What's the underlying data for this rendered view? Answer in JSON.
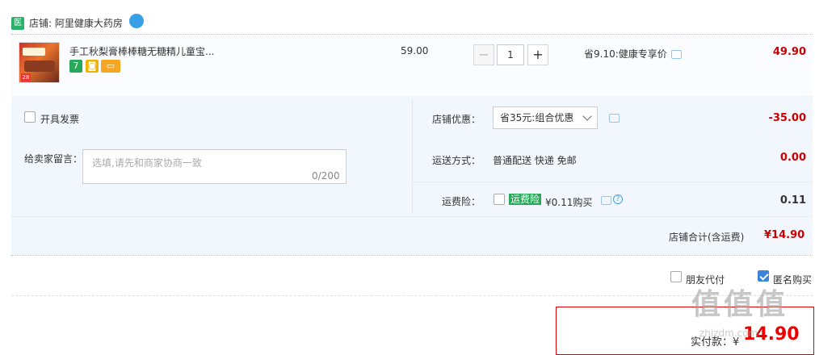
{
  "store": {
    "badge": "医",
    "name": "店铺: 阿里健康大药房"
  },
  "item": {
    "title": "手工秋梨膏棒棒糖无糖精儿童宝...",
    "thumb_badge": "28",
    "tag_seven": "7",
    "unit_price": "59.00",
    "quantity": "1",
    "minus": "−",
    "plus": "+",
    "discount": "省9.10:健康专享价",
    "total": "49.90"
  },
  "options": {
    "invoice_label": "开具发票",
    "message_label": "给卖家留言：",
    "message_placeholder": "选填,请先和商家协商一致",
    "message_count": "0/200",
    "store_discount_label": "店铺优惠：",
    "store_discount_value": "省35元:组合优惠",
    "store_discount_amount": "-35.00",
    "shipping_label": "运送方式：",
    "shipping_value": "普通配送 快递 免邮",
    "shipping_amount": "0.00",
    "insurance_label": "运费险：",
    "insurance_tag": "运费险",
    "insurance_price": "¥0.11购买",
    "insurance_amount": "0.11",
    "subtotal_label": "店铺合计(含运费)",
    "subtotal_value": "¥14.90"
  },
  "flags": {
    "friend_pay": "朋友代付",
    "anonymous": "匿名购买"
  },
  "final": {
    "label": "实付款：",
    "currency": "¥",
    "value": "14.90"
  },
  "watermark": {
    "main": "值值值",
    "sub": "zhizdm.com"
  },
  "colors": {
    "accent_red": "#cc0000",
    "link_blue": "#3b83d6",
    "panel_bg": "#f1f7fd",
    "store_green": "#2db06a"
  }
}
